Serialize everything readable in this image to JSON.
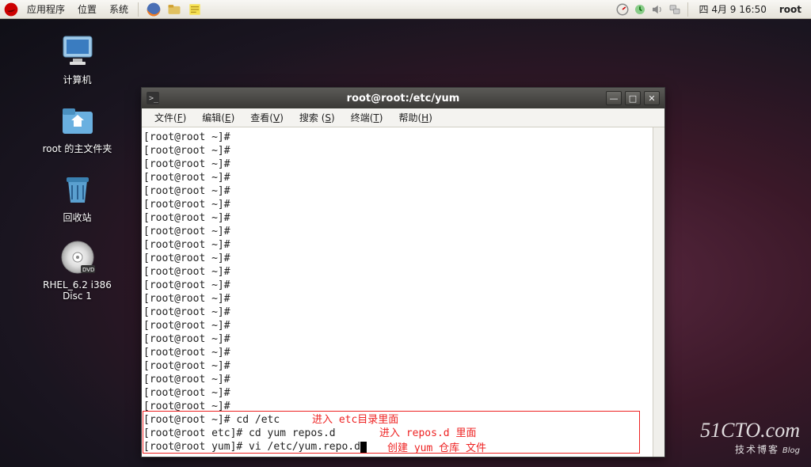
{
  "panel": {
    "menus": [
      "应用程序",
      "位置",
      "系统"
    ],
    "clock": "四  4月  9 16:50",
    "user": "root"
  },
  "desktop": {
    "icons": [
      {
        "name": "computer",
        "label": "计算机"
      },
      {
        "name": "home-folder",
        "label": "root 的主文件夹"
      },
      {
        "name": "trash",
        "label": "回收站"
      },
      {
        "name": "disc",
        "label": "RHEL_6.2 i386 Disc 1"
      }
    ]
  },
  "window": {
    "title": "root@root:/etc/yum",
    "menus": [
      {
        "label": "文件",
        "key": "F"
      },
      {
        "label": "编辑",
        "key": "E"
      },
      {
        "label": "查看",
        "key": "V"
      },
      {
        "label": "搜索",
        "key": "S"
      },
      {
        "label": "终端",
        "key": "T"
      },
      {
        "label": "帮助",
        "key": "H"
      }
    ]
  },
  "terminal": {
    "prompts": [
      "[root@root ~]#",
      "[root@root ~]#",
      "[root@root ~]#",
      "[root@root ~]#",
      "[root@root ~]#",
      "[root@root ~]#",
      "[root@root ~]#",
      "[root@root ~]#",
      "[root@root ~]#",
      "[root@root ~]#",
      "[root@root ~]#",
      "[root@root ~]#",
      "[root@root ~]#",
      "[root@root ~]#",
      "[root@root ~]#",
      "[root@root ~]#",
      "[root@root ~]#",
      "[root@root ~]#",
      "[root@root ~]#",
      "[root@root ~]#",
      "[root@root ~]#"
    ],
    "cmd_lines": [
      {
        "prompt": "[root@root ~]# ",
        "cmd": "cd /etc"
      },
      {
        "prompt": "[root@root etc]# ",
        "cmd": "cd yum repos.d"
      },
      {
        "prompt": "[root@root yum]# ",
        "cmd": "vi /etc/yum.repo.d"
      }
    ]
  },
  "annotations": [
    "进入 etc目录里面",
    "进入 repos.d 里面",
    "创建 yum 仓库 文件"
  ],
  "watermark": {
    "site": "51CTO.com",
    "sub1": "技术博客",
    "sub2": "Blog"
  }
}
